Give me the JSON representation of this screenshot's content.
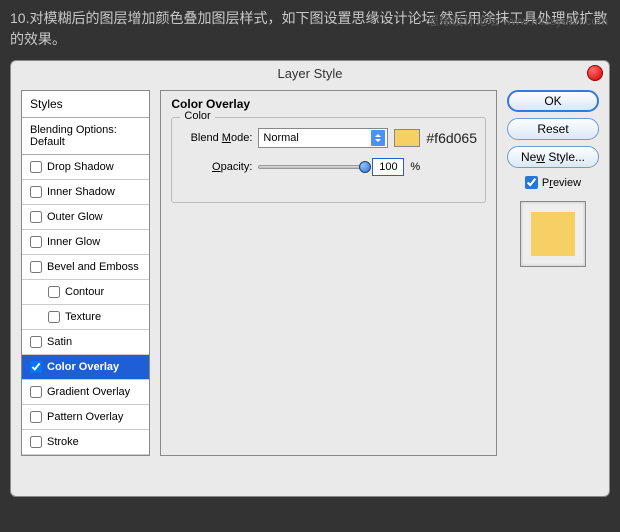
{
  "header_text": "10.对模糊后的图层增加颜色叠加图层样式，如下图设置思缘设计论坛 然后用涂抹工具处理成扩散的效果。",
  "watermark": "思缘设计论坛 www.missyuan.com",
  "dialog": {
    "title": "Layer Style",
    "sidebar": {
      "header": "Styles",
      "blending": "Blending Options: Default",
      "items": [
        {
          "label": "Drop Shadow",
          "checked": false
        },
        {
          "label": "Inner Shadow",
          "checked": false
        },
        {
          "label": "Outer Glow",
          "checked": false
        },
        {
          "label": "Inner Glow",
          "checked": false
        },
        {
          "label": "Bevel and Emboss",
          "checked": false
        },
        {
          "label": "Contour",
          "checked": false,
          "sub": true
        },
        {
          "label": "Texture",
          "checked": false,
          "sub": true
        },
        {
          "label": "Satin",
          "checked": false
        },
        {
          "label": "Color Overlay",
          "checked": true,
          "selected": true
        },
        {
          "label": "Gradient Overlay",
          "checked": false
        },
        {
          "label": "Pattern Overlay",
          "checked": false
        },
        {
          "label": "Stroke",
          "checked": false
        }
      ]
    },
    "panel": {
      "title": "Color Overlay",
      "group": "Color",
      "blend_label": "Blend Mode:",
      "blend_value": "Normal",
      "hex": "#f6d065",
      "opacity_label": "Opacity:",
      "opacity_value": "100",
      "pct": "%"
    },
    "buttons": {
      "ok": "OK",
      "reset": "Reset",
      "newstyle": "New Style...",
      "preview": "Preview"
    },
    "preview_color": "#f6d065"
  }
}
